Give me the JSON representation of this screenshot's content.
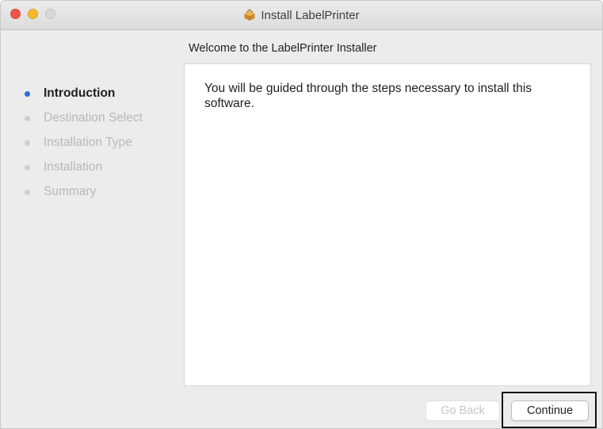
{
  "window": {
    "title": "Install LabelPrinter",
    "icon": "package-icon",
    "traffic_lights": {
      "close_color": "#f2544b",
      "minimize_color": "#f5bb2c",
      "zoom_color": "#d8d8d8"
    }
  },
  "header": {
    "welcome": "Welcome to the LabelPrinter Installer"
  },
  "sidebar": {
    "steps": [
      {
        "label": "Introduction",
        "active": true
      },
      {
        "label": "Destination Select",
        "active": false
      },
      {
        "label": "Installation Type",
        "active": false
      },
      {
        "label": "Installation",
        "active": false
      },
      {
        "label": "Summary",
        "active": false
      }
    ],
    "active_color": "#2b6fd6"
  },
  "main": {
    "body_text": "You will be guided through the steps necessary to install this software."
  },
  "footer": {
    "back_label": "Go Back",
    "continue_label": "Continue",
    "back_enabled": false
  }
}
